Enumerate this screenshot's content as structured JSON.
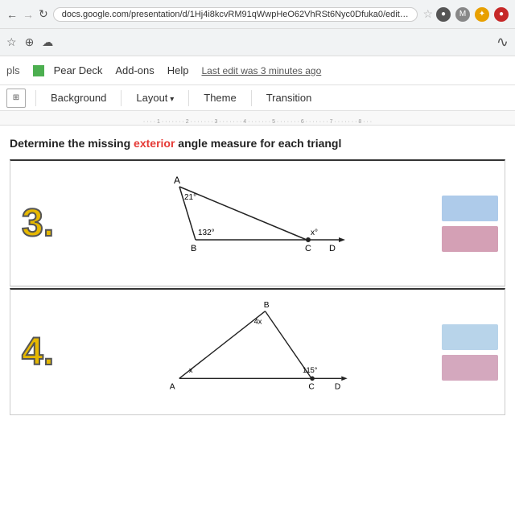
{
  "browser": {
    "url": "docs.google.com/presentation/d/1Hj4i8kcvRM91qWwpHeO62VhRSt6Nyc0Dfuka0/edit#slide=i...",
    "star_icon": "☆",
    "icons": [
      "●",
      "M",
      "●",
      "✦"
    ]
  },
  "toolbar_row": {
    "icons": [
      "☆",
      "⊕",
      "☁"
    ]
  },
  "menubar": {
    "pls_label": "pls",
    "pear_deck_label": "Pear Deck",
    "addons_label": "Add-ons",
    "help_label": "Help",
    "last_edit": "Last edit was 3 minutes ago"
  },
  "format_toolbar": {
    "grid_icon": "⊞",
    "background_label": "Background",
    "layout_label": "Layout",
    "theme_label": "Theme",
    "transition_label": "Transition"
  },
  "ruler": {
    "ticks": [
      "1",
      "2",
      "3",
      "4",
      "5",
      "6",
      "7",
      "8"
    ]
  },
  "slide": {
    "question": "Determine the missing",
    "highlight_word": "exterior",
    "question_rest": " angle measure for each triangl",
    "problem3": {
      "number": "3.",
      "points": {
        "A": "A",
        "B": "B",
        "C": "C",
        "D": "D"
      },
      "angle1": "21°",
      "angle2": "132°",
      "angle3": "x°",
      "swatches": [
        "blue-light",
        "pink"
      ]
    },
    "problem4": {
      "number": "4.",
      "points": {
        "A": "A",
        "B": "B",
        "C": "C",
        "D": "D"
      },
      "angle1": "4x",
      "angle2": "x",
      "angle3": "115°",
      "swatches": [
        "blue-light2",
        "pink2"
      ]
    }
  },
  "colors": {
    "swatch_blue": "#aecbea",
    "swatch_pink": "#d4a0b5",
    "accent_red": "#e53935",
    "number_yellow": "#e6b800"
  }
}
